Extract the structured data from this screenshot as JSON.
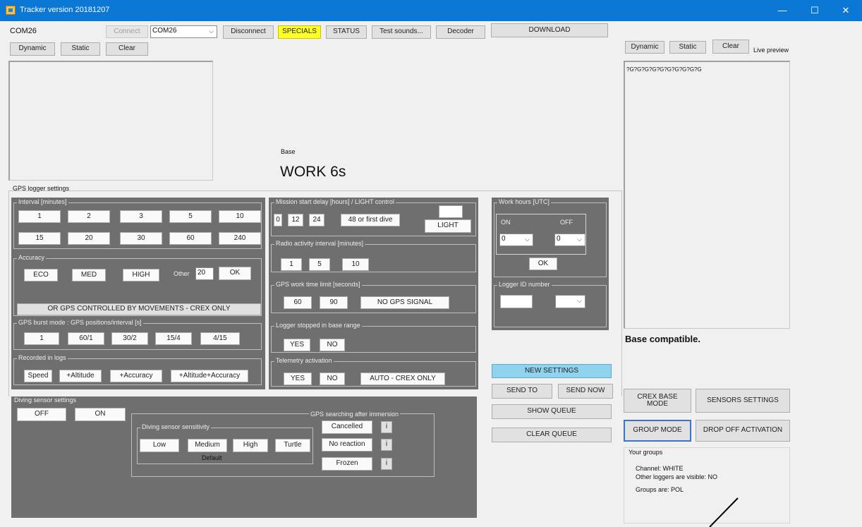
{
  "window": {
    "title": "Tracker version 20181207",
    "minimize": "—",
    "maximize": "☐",
    "close": "✕"
  },
  "toolbar": {
    "port_label": "COM26",
    "connect": "Connect",
    "port_value": "COM26",
    "disconnect": "Disconnect",
    "specials": "SPECIALS",
    "status": "STATUS",
    "test_sounds": "Test sounds...",
    "decoder": "Decoder",
    "download": "DOWNLOAD"
  },
  "left_preview": {
    "dynamic": "Dynamic",
    "static": "Static",
    "clear": "Clear"
  },
  "base": {
    "label": "Base",
    "status": "WORK 6s"
  },
  "right_preview": {
    "dynamic": "Dynamic",
    "static": "Static",
    "clear": "Clear",
    "live_label": "Live preview",
    "content": "?G?G?G?G?G?G?G?G?G?G"
  },
  "gps": {
    "title": "GPS logger settings",
    "interval_legend": "Interval [minutes]",
    "intervals": [
      "1",
      "2",
      "3",
      "5",
      "10",
      "15",
      "20",
      "30",
      "60",
      "240"
    ],
    "accuracy_legend": "Accuracy",
    "eco": "ECO",
    "med": "MED",
    "high": "HIGH",
    "other_label": "Other",
    "other_value": "20",
    "ok": "OK",
    "movement": "OR GPS CONTROLLED BY MOVEMENTS - CREX ONLY",
    "burst_legend": "GPS burst mode : GPS positions/interval [s]",
    "burst": [
      "1",
      "60/1",
      "30/2",
      "15/4",
      "4/15"
    ],
    "recorded_legend": "Recorded in logs",
    "recorded": [
      "Speed",
      "+Altitude",
      "+Accuracy",
      "+Altitude+Accuracy"
    ]
  },
  "mission": {
    "legend": "Mission start delay [hours] / LIGHT control",
    "delays": [
      "0",
      "12",
      "24",
      "48 or first dive"
    ],
    "light": "LIGHT"
  },
  "radio": {
    "legend": "Radio activity interval  [minutes]",
    "values": [
      "1",
      "5",
      "10"
    ]
  },
  "gps_limit": {
    "legend": "GPS work time limit [seconds]",
    "values": [
      "60",
      "90"
    ],
    "no_signal": "NO GPS SIGNAL"
  },
  "stopped": {
    "legend": "Logger stopped in base range",
    "yes": "YES",
    "no": "NO"
  },
  "telemetry": {
    "legend": "Telemetry activation",
    "yes": "YES",
    "no": "NO",
    "auto": "AUTO - CREX ONLY"
  },
  "work_hours": {
    "legend": "Work hours [UTC]",
    "on_label": "ON",
    "off_label": "OFF",
    "on_value": "0",
    "off_value": "0",
    "ok": "OK"
  },
  "logger_id": {
    "legend": "Logger ID number"
  },
  "diving": {
    "title": "Diving sensor settings",
    "off": "OFF",
    "on": "ON",
    "sens_legend": "Diving sensor sensitivity",
    "sens": [
      "Low",
      "Medium",
      "High",
      "Turtle"
    ],
    "default": "Default",
    "search_legend": "GPS searching after immersion",
    "search": [
      "Cancelled",
      "No reaction",
      "Frozen"
    ],
    "info": "i"
  },
  "queue": {
    "new_settings": "NEW SETTINGS",
    "send_to": "SEND TO",
    "send_now": "SEND NOW",
    "show_queue": "SHOW QUEUE",
    "clear_queue": "CLEAR QUEUE"
  },
  "right": {
    "compat": "Base compatible.",
    "crex_base": "CREX BASE MODE",
    "sensors": "SENSORS SETTINGS",
    "group_mode": "GROUP MODE",
    "drop_off": "DROP OFF ACTIVATION",
    "groups_title": "Your groups",
    "channel": "Channel:  WHITE",
    "visible": "Other loggers are visible:    NO",
    "groups_are": "Groups are:   POL"
  }
}
